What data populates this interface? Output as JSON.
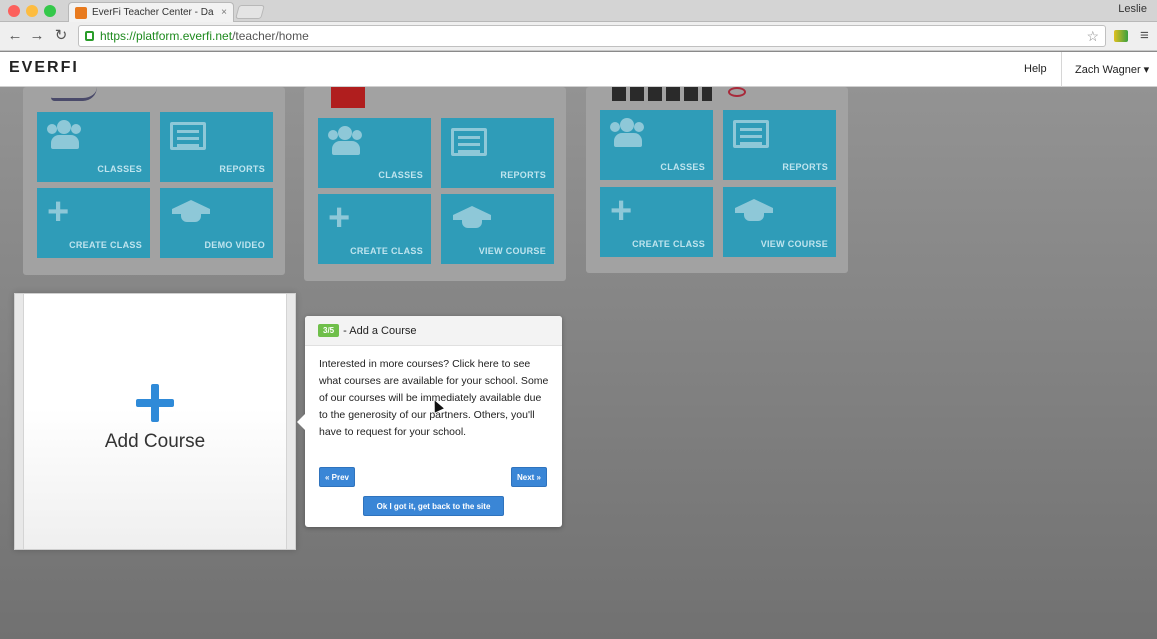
{
  "browser": {
    "tab_title": "EverFi Teacher Center - Da",
    "tab_close": "×",
    "profile_name": "Leslie",
    "url_secure": "https://platform.everfi.net",
    "url_path": "/teacher/home",
    "back_glyph": "←",
    "forward_glyph": "→",
    "reload_glyph": "↻",
    "star_glyph": "☆",
    "menu_glyph": "≡"
  },
  "header": {
    "logo": "EVERFI",
    "help_label": "Help",
    "user_label": "Zach Wagner ▾"
  },
  "courses": [
    {
      "tiles": [
        {
          "label": "CLASSES",
          "icon": "people-icon"
        },
        {
          "label": "REPORTS",
          "icon": "report-icon"
        },
        {
          "label": "CREATE CLASS",
          "icon": "plus-icon"
        },
        {
          "label": "DEMO VIDEO",
          "icon": "graduation-cap-icon"
        }
      ]
    },
    {
      "tiles": [
        {
          "label": "CLASSES",
          "icon": "people-icon"
        },
        {
          "label": "REPORTS",
          "icon": "report-icon"
        },
        {
          "label": "CREATE CLASS",
          "icon": "plus-icon"
        },
        {
          "label": "VIEW COURSE",
          "icon": "graduation-cap-icon"
        }
      ]
    },
    {
      "tiles": [
        {
          "label": "CLASSES",
          "icon": "people-icon"
        },
        {
          "label": "REPORTS",
          "icon": "report-icon"
        },
        {
          "label": "CREATE CLASS",
          "icon": "plus-icon"
        },
        {
          "label": "VIEW COURSE",
          "icon": "graduation-cap-icon"
        }
      ]
    }
  ],
  "add_course": {
    "label": "Add Course"
  },
  "tour": {
    "step": "3/5",
    "title": "- Add a Course",
    "body": "Interested in more courses? Click here to see what courses are available for your school. Some of our courses will be immediately available due to the generosity of our partners. Others, you'll have to request for your school.",
    "prev_label": "« Prev",
    "next_label": "Next »",
    "ok_label": "Ok I got it, get back to the site"
  },
  "colors": {
    "tile": "#2f9cb8",
    "accent_blue": "#3a86d6",
    "step_badge": "#6fbf4a"
  }
}
